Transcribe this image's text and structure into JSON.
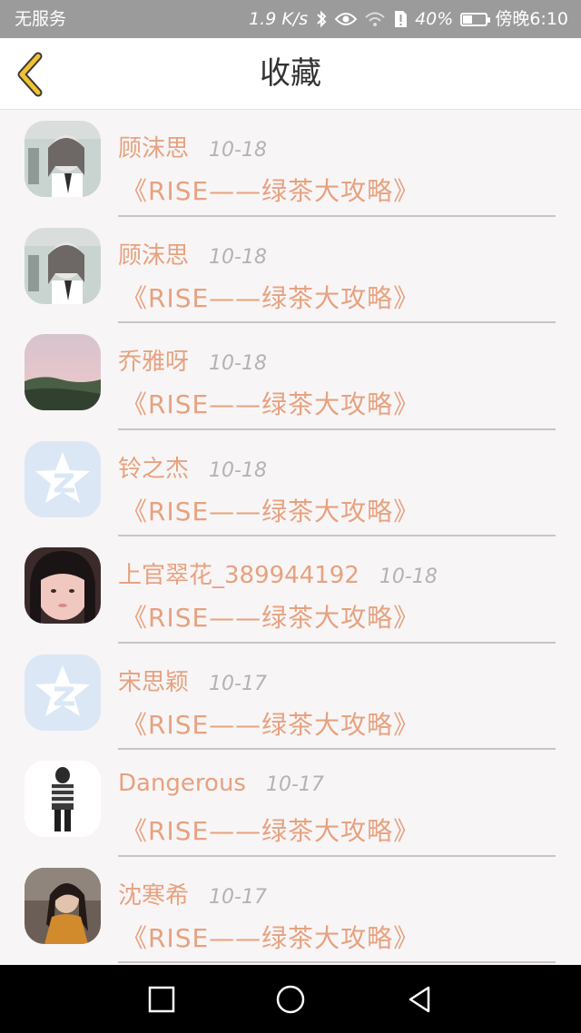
{
  "status_bar": {
    "carrier": "无服务",
    "speed": "1.9 K/s",
    "battery_percent": "40%",
    "battery_level": 0.4,
    "time": "傍晚6:10"
  },
  "header": {
    "title": "收藏"
  },
  "favorites": [
    {
      "name": "顾沫思",
      "date": "10-18",
      "title": "《RISE——绿茶大攻略》",
      "avatar": "photo-girl-gray"
    },
    {
      "name": "顾沫思",
      "date": "10-18",
      "title": "《RISE——绿茶大攻略》",
      "avatar": "photo-girl-gray"
    },
    {
      "name": "乔雅呀",
      "date": "10-18",
      "title": "《RISE——绿茶大攻略》",
      "avatar": "photo-landscape-pink"
    },
    {
      "name": "铃之杰",
      "date": "10-18",
      "title": "《RISE——绿茶大攻略》",
      "avatar": "default-qzone-star"
    },
    {
      "name": "上官翠花_389944192",
      "date": "10-18",
      "title": "《RISE——绿茶大攻略》",
      "avatar": "photo-girl-face"
    },
    {
      "name": "宋思颖",
      "date": "10-17",
      "title": "《RISE——绿茶大攻略》",
      "avatar": "default-qzone-star"
    },
    {
      "name": "Dangerous",
      "date": "10-17",
      "title": "《RISE——绿茶大攻略》",
      "avatar": "photo-figure-white"
    },
    {
      "name": "沈寒希",
      "date": "10-17",
      "title": "《RISE——绿茶大攻略》",
      "avatar": "photo-girl-dark"
    }
  ],
  "icons": {
    "back": "chevron-left-icon",
    "nav_back": "triangle-back-icon",
    "nav_home": "circle-home-icon",
    "nav_recent": "square-recent-icon"
  },
  "colors": {
    "accent": "#e6a27f",
    "back_chevron": "#f2c230",
    "date": "#b3b3b3"
  }
}
